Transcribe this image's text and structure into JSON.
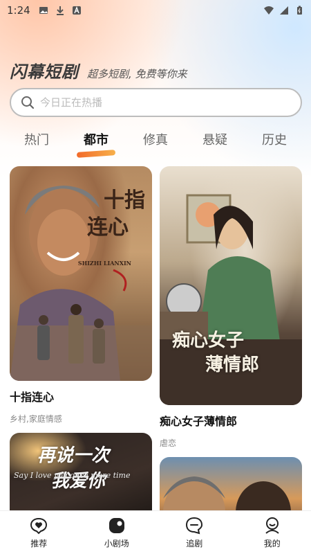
{
  "status_bar": {
    "time": "1:24",
    "left_icons": [
      "image-icon",
      "download-icon",
      "font-icon"
    ],
    "right_icons": [
      "wifi-icon",
      "signal-icon",
      "battery-icon"
    ]
  },
  "header": {
    "title": "闪幕短剧",
    "slogan": "超多短剧, 免费等你来"
  },
  "search": {
    "placeholder": "今日正在热播"
  },
  "tabs": [
    {
      "label": "热门"
    },
    {
      "label": "都市",
      "active": true
    },
    {
      "label": "修真"
    },
    {
      "label": "悬疑"
    },
    {
      "label": "历史"
    }
  ],
  "feed": {
    "left": [
      {
        "poster_art": {
          "line1": "十指",
          "line2": "连心",
          "en": "SHIZHI LIANXIN"
        },
        "title": "十指连心",
        "tags": "乡村,家庭情感"
      },
      {
        "poster_art": {
          "line1": "再说一次",
          "line2": "我爱你",
          "en": "Say I love you once more time"
        }
      }
    ],
    "right": [
      {
        "poster_art": {
          "line1": "痴心女子",
          "line2": "薄情郎"
        },
        "title": "痴心女子薄情郎",
        "tags": "虐恋"
      },
      {}
    ]
  },
  "bottom_nav": [
    {
      "label": "推荐",
      "icon": "heart-chat-icon"
    },
    {
      "label": "小剧场",
      "icon": "theater-icon"
    },
    {
      "label": "追剧",
      "icon": "chat-bubble-icon"
    },
    {
      "label": "我的",
      "icon": "user-icon"
    }
  ]
}
